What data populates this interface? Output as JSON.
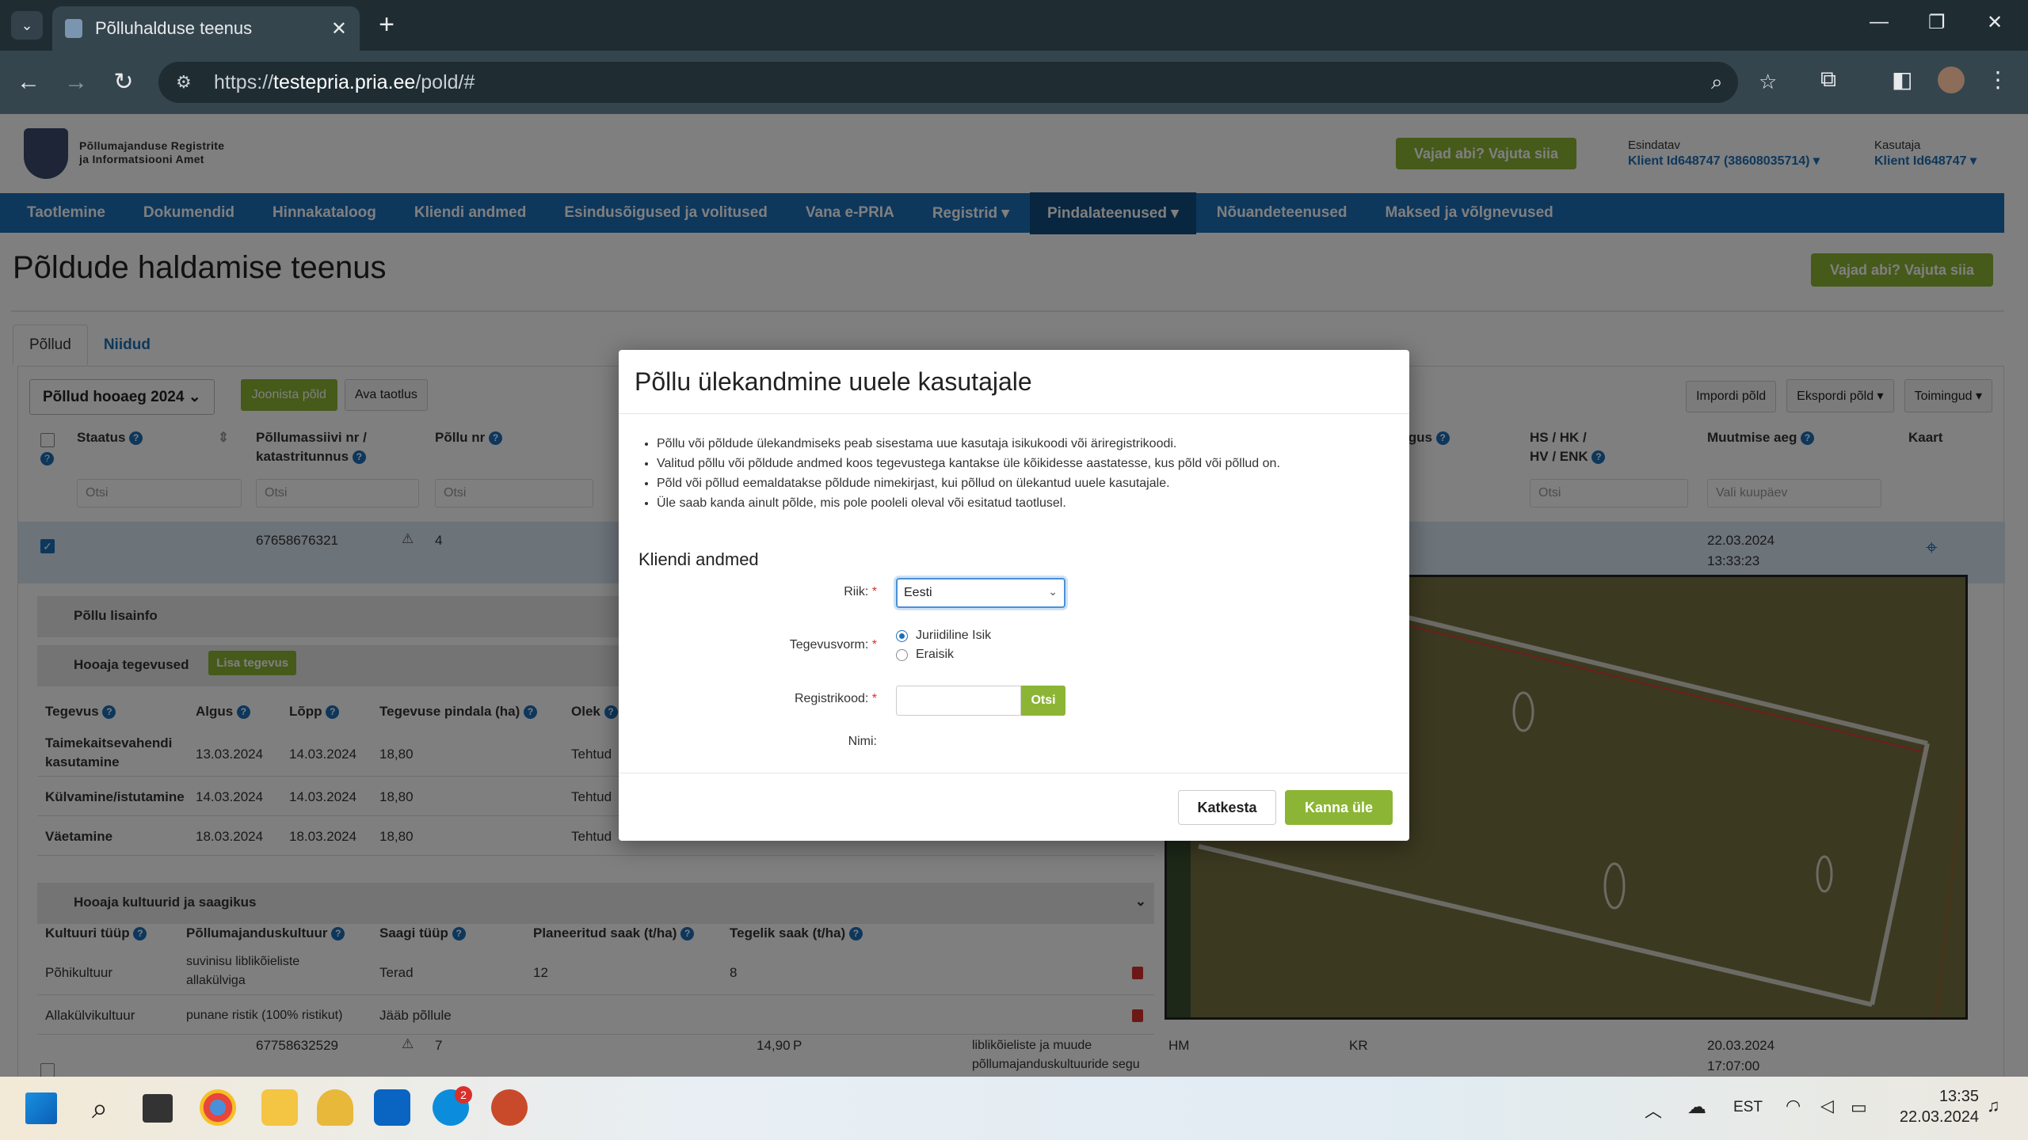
{
  "browser": {
    "tab_title": "Põlluhalduse teenus",
    "url_host": "testepria.pria.ee",
    "url_path": "/pold/#",
    "url_scheme": "https://"
  },
  "header": {
    "org_line1": "Põllumajanduse Registrite",
    "org_line2": "ja Informatsiooni Amet",
    "help_button": "Vajad abi? Vajuta siia",
    "representative_label": "Esindatav",
    "representative_value": "Klient Id648747 (38608035714)",
    "user_label": "Kasutaja",
    "user_value": "Klient Id648747"
  },
  "nav": {
    "items": [
      "Taotlemine",
      "Dokumendid",
      "Hinnakataloog",
      "Kliendi andmed",
      "Esindusõigused ja volitused",
      "Vana e-PRIA",
      "Registrid ▾",
      "Pindalateenused ▾",
      "Nõuandeteenused",
      "Maksed ja võlgnevused"
    ]
  },
  "page": {
    "title": "Põldude haldamise teenus",
    "help_button": "Vajad abi? Vajuta siia",
    "tab_fields": "Põllud",
    "tab_meadows": "Niidud"
  },
  "table": {
    "season_select": "Põllud hooaeg 2024",
    "draw_button": "Joonista põld",
    "open_app_button": "Ava taotlus",
    "import_button": "Impordi põld",
    "export_button": "Ekspordi põld ▾",
    "actions_button": "Toimingud ▾",
    "col_status": "Staatus",
    "col_block": "Põllumassiivi nr /",
    "col_block2": "katastritunnus",
    "col_field": "Põllu nr",
    "col_right_partial": "igus",
    "col_hs": "HS / HK /",
    "col_hs2": "HV / ENK",
    "col_modified": "Muutmise aeg",
    "col_map": "Kaart",
    "filter_placeholder": "Otsi",
    "date_placeholder": "Vali kuupäev",
    "row1": {
      "block": "67658676321",
      "field": "4",
      "date": "22.03.2024",
      "time": "13:33:23"
    },
    "row2": {
      "block": "67758632529",
      "field": "7",
      "area": "14,90",
      "p": "P",
      "culture1": "liblikõieliste ja muude",
      "culture2": "põllumajanduskultuuride segu",
      "hs": "HM",
      "kr": "KR",
      "date": "20.03.2024",
      "time": "17:07:00"
    }
  },
  "detail": {
    "extra_info": "Põllu lisainfo",
    "season_activities": "Hooaja tegevused",
    "add_activity": "Lisa tegevus",
    "act_headers": [
      "Tegevus",
      "Algus",
      "Lõpp",
      "Tegevuse pindala (ha)",
      "Olek"
    ],
    "activities": [
      {
        "name1": "Taimekaitsevahendi",
        "name2": "kasutamine",
        "start": "13.03.2024",
        "end": "14.03.2024",
        "area": "18,80",
        "state": "Tehtud"
      },
      {
        "name1": "Külvamine/istutamine",
        "name2": "",
        "start": "14.03.2024",
        "end": "14.03.2024",
        "area": "18,80",
        "state": "Tehtud"
      },
      {
        "name1": "Väetamine",
        "name2": "",
        "start": "18.03.2024",
        "end": "18.03.2024",
        "area": "18,80",
        "state": "Tehtud"
      }
    ],
    "crops_title": "Hooaja kultuurid ja saagikus",
    "crop_headers": [
      "Kultuuri tüüp",
      "Põllumajanduskultuur",
      "Saagi tüüp",
      "Planeeritud saak (t/ha)",
      "Tegelik saak (t/ha)"
    ],
    "crops": [
      {
        "type": "Põhikultuur",
        "culture1": "suvinisu liblikõieliste",
        "culture2": "allakülviga",
        "yield_type": "Terad",
        "planned": "12",
        "actual": "8"
      },
      {
        "type": "Allakülvikultuur",
        "culture1": "punane ristik (100% ristikut)",
        "culture2": "",
        "yield_type": "Jääb põllule",
        "planned": "",
        "actual": ""
      }
    ]
  },
  "modal": {
    "title": "Põllu ülekandmine uuele kasutajale",
    "bullets": [
      "Põllu või põldude ülekandmiseks peab sisestama uue kasutaja isikukoodi või äriregistrikoodi.",
      "Valitud põllu või põldude andmed koos tegevustega kantakse üle kõikidesse aastatesse, kus põld või põllud on.",
      "Põld või põllud eemaldatakse põldude nimekirjast, kui põllud on ülekantud uuele kasutajale.",
      "Üle saab kanda ainult põlde, mis pole pooleli oleval või esitatud taotlusel."
    ],
    "section": "Kliendi andmed",
    "country_label": "Riik:",
    "country_value": "Eesti",
    "form_label": "Tegevusvorm:",
    "form_opt1": "Juriidiline Isik",
    "form_opt2": "Eraisik",
    "reg_label": "Registrikood:",
    "search_button": "Otsi",
    "name_label": "Nimi:",
    "cancel_button": "Katkesta",
    "transfer_button": "Kanna üle",
    "required_mark": "*"
  },
  "taskbar": {
    "lang": "EST",
    "time": "13:35",
    "date": "22.03.2024",
    "skype_badge": "2"
  },
  "colors": {
    "accent_blue": "#1c6fb8",
    "green": "#8cb535"
  }
}
